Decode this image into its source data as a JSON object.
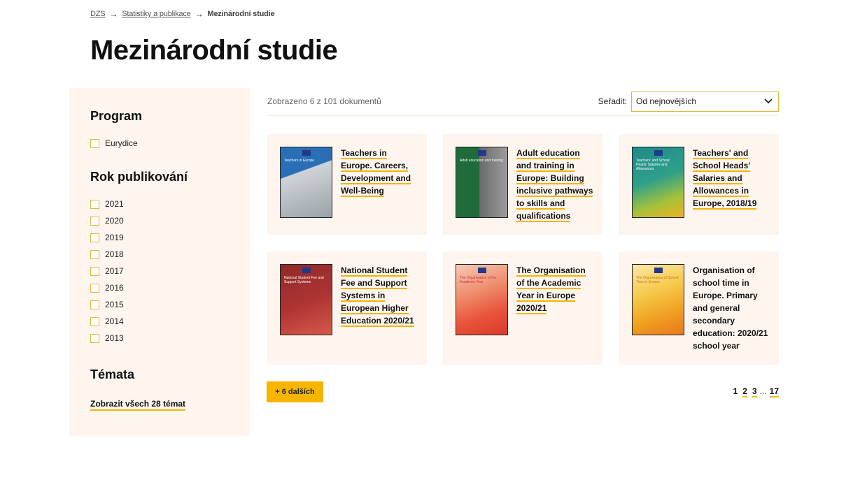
{
  "breadcrumb": {
    "home": "DZS",
    "section": "Statistiky a publikace",
    "current": "Mezinárodní studie"
  },
  "page_title": "Mezinárodní studie",
  "sidebar": {
    "program_heading": "Program",
    "program_items": [
      "Eurydice"
    ],
    "year_heading": "Rok publikování",
    "years": [
      "2021",
      "2020",
      "2019",
      "2018",
      "2017",
      "2016",
      "2015",
      "2014",
      "2013"
    ],
    "topics_heading": "Témata",
    "topics_link": "Zobrazit všech 28 témat"
  },
  "toolbar": {
    "count": "Zobrazeno 6 z 101 dokumentů",
    "sort_label": "Seřadit:",
    "sort_value": "Od nejnovějších"
  },
  "cards": [
    {
      "title": "Teachers in Europe. Careers, Development and Well-Being",
      "linked": true,
      "cover_color": "#2a6fb5",
      "cover_text": "Teachers in Europe"
    },
    {
      "title": "Adult education and training in Europe: Building inclusive pathways to skills and qualifications",
      "linked": true,
      "cover_color": "#1f6b3a",
      "cover_text": "Adult education and training"
    },
    {
      "title": "Teachers' and School Heads' Salaries and Allowances in Europe, 2018/19",
      "linked": true,
      "cover_color": "#1f8a8a",
      "cover_text": "Teachers' and School Heads' Salaries and Allowances"
    },
    {
      "title": "National Student Fee and Support Systems in European Higher Education 2020/21",
      "linked": true,
      "cover_color": "#9b2b2b",
      "cover_text": "National Student Fee and Support Systems"
    },
    {
      "title": "The Organisation of the Academic Year in Europe 2020/21",
      "linked": true,
      "cover_color": "#e8533a",
      "cover_text": "The Organisation of the Academic Year"
    },
    {
      "title": "Organisation of school time in Europe. Primary and general secondary education: 2020/21 school year",
      "linked": false,
      "cover_color": "#f0a020",
      "cover_text": "The Organisation of School Time in Europe"
    }
  ],
  "more_button": "+ 6 dalších",
  "pagination": {
    "current": "1",
    "pages": [
      "2",
      "3"
    ],
    "ellipsis": "...",
    "last": "17"
  },
  "colors": {
    "accent": "#f7b500",
    "panel_bg": "#fdf5ee"
  }
}
